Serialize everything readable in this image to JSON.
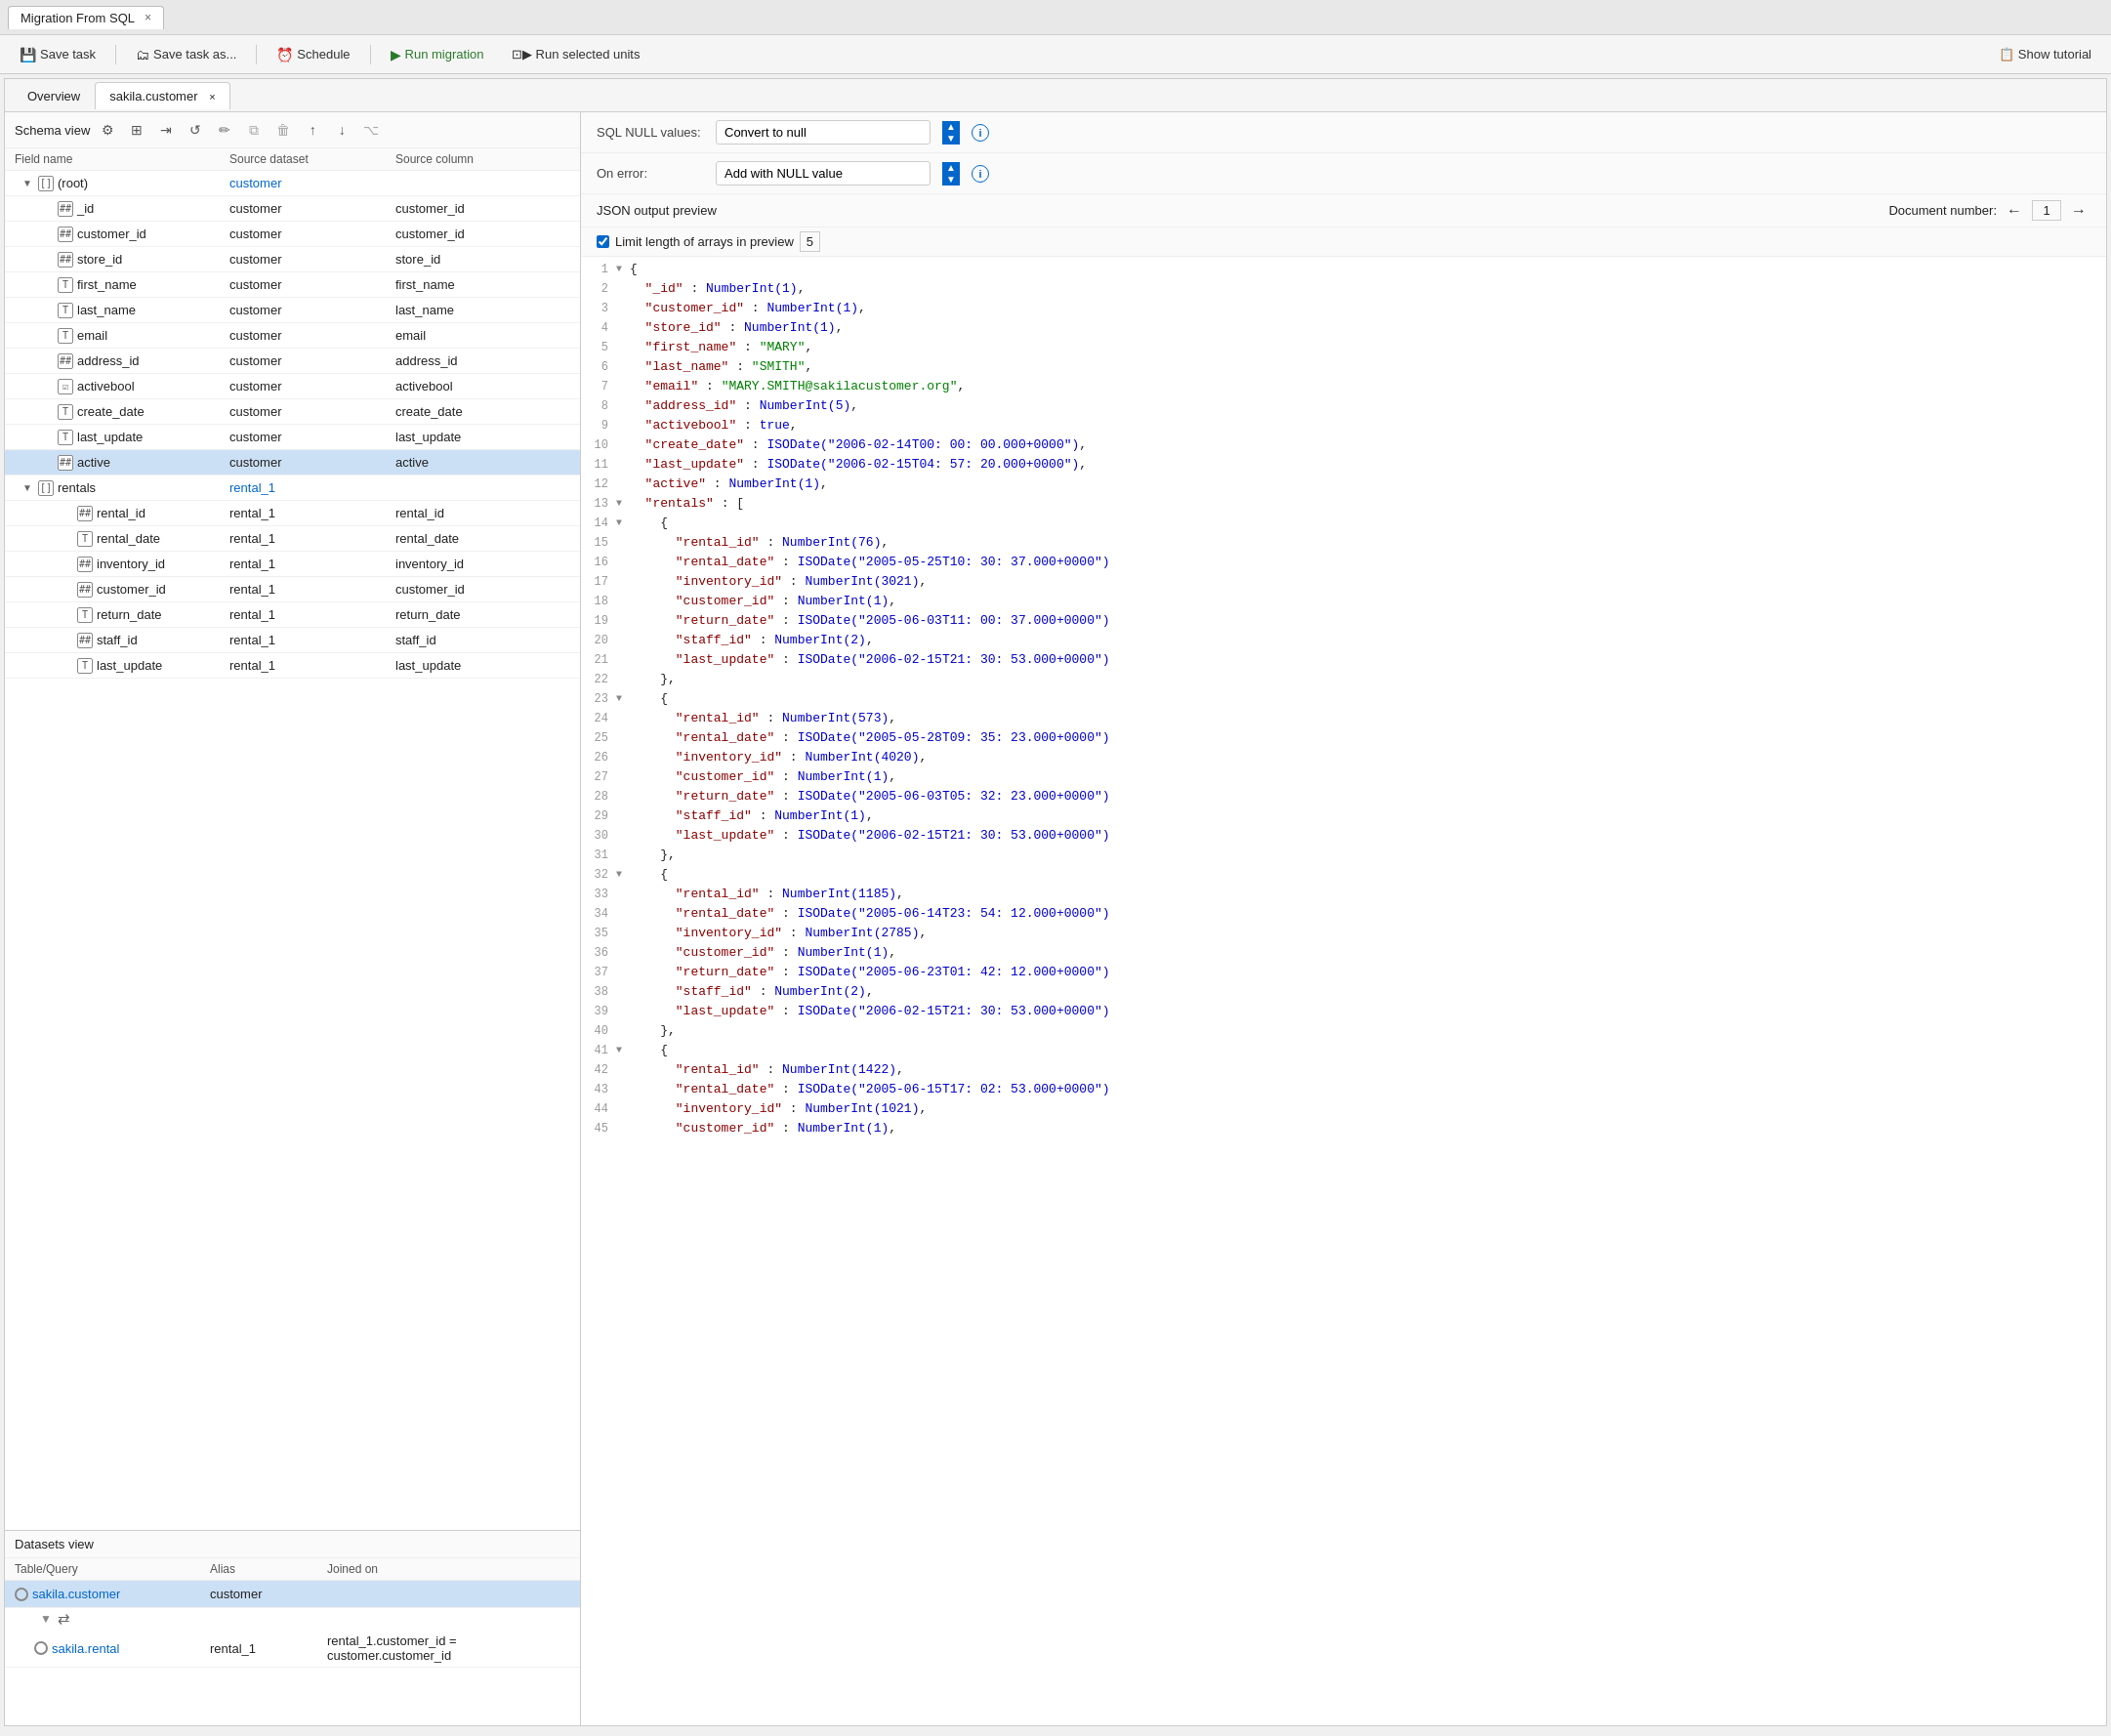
{
  "titleBar": {
    "tabLabel": "Migration From SQL",
    "closeBtn": "×"
  },
  "toolbar": {
    "saveTask": "Save task",
    "saveTaskAs": "Save task as...",
    "schedule": "Schedule",
    "runMigration": "Run migration",
    "runSelected": "Run selected units",
    "showTutorial": "Show tutorial"
  },
  "subtabs": {
    "overview": "Overview",
    "sakila": "sakila.customer",
    "closeBtn": "×"
  },
  "schemaView": {
    "label": "Schema view",
    "colHeaders": [
      "Field name",
      "Source dataset",
      "Source column"
    ]
  },
  "treeRows": [
    {
      "indent": 0,
      "expand": "▼",
      "icon": "[]",
      "name": "(root)",
      "source": "customer",
      "sourceLink": true,
      "column": ""
    },
    {
      "indent": 1,
      "expand": "",
      "icon": "##",
      "name": "_id",
      "source": "customer",
      "sourceLink": false,
      "column": "customer_id"
    },
    {
      "indent": 1,
      "expand": "",
      "icon": "##",
      "name": "customer_id",
      "source": "customer",
      "sourceLink": false,
      "column": "customer_id"
    },
    {
      "indent": 1,
      "expand": "",
      "icon": "##",
      "name": "store_id",
      "source": "customer",
      "sourceLink": false,
      "column": "store_id"
    },
    {
      "indent": 1,
      "expand": "",
      "icon": "T",
      "name": "first_name",
      "source": "customer",
      "sourceLink": false,
      "column": "first_name"
    },
    {
      "indent": 1,
      "expand": "",
      "icon": "T",
      "name": "last_name",
      "source": "customer",
      "sourceLink": false,
      "column": "last_name"
    },
    {
      "indent": 1,
      "expand": "",
      "icon": "T",
      "name": "email",
      "source": "customer",
      "sourceLink": false,
      "column": "email"
    },
    {
      "indent": 1,
      "expand": "",
      "icon": "##",
      "name": "address_id",
      "source": "customer",
      "sourceLink": false,
      "column": "address_id"
    },
    {
      "indent": 1,
      "expand": "",
      "icon": "☑",
      "name": "activebool",
      "source": "customer",
      "sourceLink": false,
      "column": "activebool"
    },
    {
      "indent": 1,
      "expand": "",
      "icon": "T",
      "name": "create_date",
      "source": "customer",
      "sourceLink": false,
      "column": "create_date"
    },
    {
      "indent": 1,
      "expand": "",
      "icon": "T",
      "name": "last_update",
      "source": "customer",
      "sourceLink": false,
      "column": "last_update"
    },
    {
      "indent": 1,
      "expand": "",
      "icon": "##",
      "name": "active",
      "source": "customer",
      "sourceLink": false,
      "column": "active",
      "selected": true
    },
    {
      "indent": 0,
      "expand": "▼",
      "icon": "[]",
      "name": "rentals",
      "source": "rental_1",
      "sourceLink": true,
      "column": ""
    },
    {
      "indent": 2,
      "expand": "",
      "icon": "##",
      "name": "rental_id",
      "source": "rental_1",
      "sourceLink": false,
      "column": "rental_id"
    },
    {
      "indent": 2,
      "expand": "",
      "icon": "T",
      "name": "rental_date",
      "source": "rental_1",
      "sourceLink": false,
      "column": "rental_date"
    },
    {
      "indent": 2,
      "expand": "",
      "icon": "##",
      "name": "inventory_id",
      "source": "rental_1",
      "sourceLink": false,
      "column": "inventory_id"
    },
    {
      "indent": 2,
      "expand": "",
      "icon": "##",
      "name": "customer_id",
      "source": "rental_1",
      "sourceLink": false,
      "column": "customer_id"
    },
    {
      "indent": 2,
      "expand": "",
      "icon": "T",
      "name": "return_date",
      "source": "rental_1",
      "sourceLink": false,
      "column": "return_date"
    },
    {
      "indent": 2,
      "expand": "",
      "icon": "##",
      "name": "staff_id",
      "source": "rental_1",
      "sourceLink": false,
      "column": "staff_id"
    },
    {
      "indent": 2,
      "expand": "",
      "icon": "T",
      "name": "last_update",
      "source": "rental_1",
      "sourceLink": false,
      "column": "last_update"
    }
  ],
  "datasetsView": {
    "label": "Datasets view",
    "colHeaders": [
      "Table/Query",
      "Alias",
      "Joined on"
    ],
    "rows": [
      {
        "table": "sakila.customer",
        "alias": "customer",
        "joinedOn": "",
        "selected": true
      },
      {
        "table": "sakila.rental",
        "alias": "rental_1",
        "joinedOn": "rental_1.customer_id = customer.customer_id",
        "selected": false
      }
    ]
  },
  "settings": {
    "nullLabel": "SQL NULL values:",
    "nullValue": "Convert to null",
    "errorLabel": "On error:",
    "errorValue": "Add with NULL value"
  },
  "previewHeader": {
    "label": "JSON output preview",
    "docLabel": "Document number:",
    "docNum": "1",
    "limitLabel": "Limit length of arrays in preview",
    "limitNum": "5",
    "limitChecked": true
  },
  "jsonLines": [
    {
      "num": 1,
      "arrow": "▼",
      "content": "{"
    },
    {
      "num": 2,
      "arrow": "",
      "content": "  \"_id\" : NumberInt(1),"
    },
    {
      "num": 3,
      "arrow": "",
      "content": "  \"customer_id\" : NumberInt(1),"
    },
    {
      "num": 4,
      "arrow": "",
      "content": "  \"store_id\" : NumberInt(1),"
    },
    {
      "num": 5,
      "arrow": "",
      "content": "  \"first_name\" : \"MARY\","
    },
    {
      "num": 6,
      "arrow": "",
      "content": "  \"last_name\" : \"SMITH\","
    },
    {
      "num": 7,
      "arrow": "",
      "content": "  \"email\" : \"MARY.SMITH@sakilacustomer.org\","
    },
    {
      "num": 8,
      "arrow": "",
      "content": "  \"address_id\" : NumberInt(5),"
    },
    {
      "num": 9,
      "arrow": "",
      "content": "  \"activebool\" : true,"
    },
    {
      "num": 10,
      "arrow": "",
      "content": "  \"create_date\" : ISODate(\"2006-02-14T00:00:00.000+0000\"),"
    },
    {
      "num": 11,
      "arrow": "",
      "content": "  \"last_update\" : ISODate(\"2006-02-15T04:57:20.000+0000\"),"
    },
    {
      "num": 12,
      "arrow": "",
      "content": "  \"active\" : NumberInt(1),"
    },
    {
      "num": 13,
      "arrow": "▼",
      "content": "  \"rentals\" : ["
    },
    {
      "num": 14,
      "arrow": "▼",
      "content": "    {"
    },
    {
      "num": 15,
      "arrow": "",
      "content": "      \"rental_id\" : NumberInt(76),"
    },
    {
      "num": 16,
      "arrow": "",
      "content": "      \"rental_date\" : ISODate(\"2005-05-25T10:30:37.000+0000\")"
    },
    {
      "num": 17,
      "arrow": "",
      "content": "      \"inventory_id\" : NumberInt(3021),"
    },
    {
      "num": 18,
      "arrow": "",
      "content": "      \"customer_id\" : NumberInt(1),"
    },
    {
      "num": 19,
      "arrow": "",
      "content": "      \"return_date\" : ISODate(\"2005-06-03T11:00:37.000+0000\")"
    },
    {
      "num": 20,
      "arrow": "",
      "content": "      \"staff_id\" : NumberInt(2),"
    },
    {
      "num": 21,
      "arrow": "",
      "content": "      \"last_update\" : ISODate(\"2006-02-15T21:30:53.000+0000\")"
    },
    {
      "num": 22,
      "arrow": "",
      "content": "    },"
    },
    {
      "num": 23,
      "arrow": "▼",
      "content": "    {"
    },
    {
      "num": 24,
      "arrow": "",
      "content": "      \"rental_id\" : NumberInt(573),"
    },
    {
      "num": 25,
      "arrow": "",
      "content": "      \"rental_date\" : ISODate(\"2005-05-28T09:35:23.000+0000\")"
    },
    {
      "num": 26,
      "arrow": "",
      "content": "      \"inventory_id\" : NumberInt(4020),"
    },
    {
      "num": 27,
      "arrow": "",
      "content": "      \"customer_id\" : NumberInt(1),"
    },
    {
      "num": 28,
      "arrow": "",
      "content": "      \"return_date\" : ISODate(\"2005-06-03T05:32:23.000+0000\")"
    },
    {
      "num": 29,
      "arrow": "",
      "content": "      \"staff_id\" : NumberInt(1),"
    },
    {
      "num": 30,
      "arrow": "",
      "content": "      \"last_update\" : ISODate(\"2006-02-15T21:30:53.000+0000\")"
    },
    {
      "num": 31,
      "arrow": "",
      "content": "    },"
    },
    {
      "num": 32,
      "arrow": "▼",
      "content": "    {"
    },
    {
      "num": 33,
      "arrow": "",
      "content": "      \"rental_id\" : NumberInt(1185),"
    },
    {
      "num": 34,
      "arrow": "",
      "content": "      \"rental_date\" : ISODate(\"2005-06-14T23:54:12.000+0000\")"
    },
    {
      "num": 35,
      "arrow": "",
      "content": "      \"inventory_id\" : NumberInt(2785),"
    },
    {
      "num": 36,
      "arrow": "",
      "content": "      \"customer_id\" : NumberInt(1),"
    },
    {
      "num": 37,
      "arrow": "",
      "content": "      \"return_date\" : ISODate(\"2005-06-23T01:42:12.000+0000\")"
    },
    {
      "num": 38,
      "arrow": "",
      "content": "      \"staff_id\" : NumberInt(2),"
    },
    {
      "num": 39,
      "arrow": "",
      "content": "      \"last_update\" : ISODate(\"2006-02-15T21:30:53.000+0000\")"
    },
    {
      "num": 40,
      "arrow": "",
      "content": "    },"
    },
    {
      "num": 41,
      "arrow": "▼",
      "content": "    {"
    },
    {
      "num": 42,
      "arrow": "",
      "content": "      \"rental_id\" : NumberInt(1422),"
    },
    {
      "num": 43,
      "arrow": "",
      "content": "      \"rental_date\" : ISODate(\"2005-06-15T17:02:53.000+0000\")"
    },
    {
      "num": 44,
      "arrow": "",
      "content": "      \"inventory_id\" : NumberInt(1021),"
    },
    {
      "num": 45,
      "arrow": "",
      "content": "      \"customer_id\" : NumberInt(1),"
    }
  ]
}
